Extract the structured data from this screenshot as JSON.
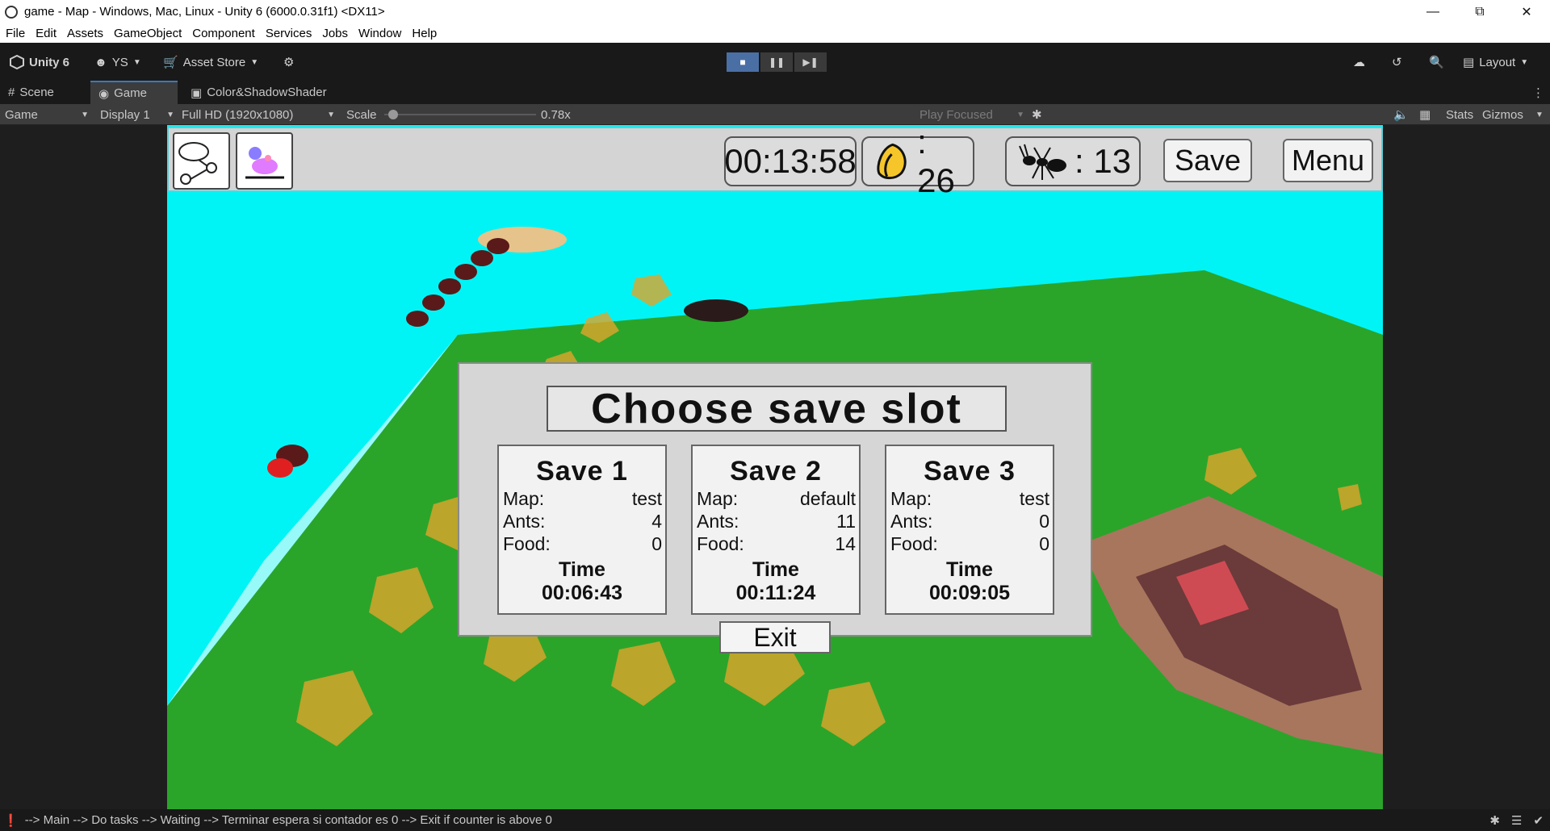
{
  "window": {
    "title": "game - Map - Windows, Mac, Linux - Unity 6 (6000.0.31f1) <DX11>",
    "minimize_icon": "minimize-icon",
    "maximize_icon": "restore-icon",
    "close_icon": "close-icon"
  },
  "menu": [
    "File",
    "Edit",
    "Assets",
    "GameObject",
    "Component",
    "Services",
    "Jobs",
    "Window",
    "Help"
  ],
  "toolbar": {
    "unity_label": "Unity 6",
    "account_label": "YS",
    "asset_store_label": "Asset Store",
    "layout_label": "Layout"
  },
  "tabs": [
    "Scene",
    "Game",
    "Color&ShadowShader"
  ],
  "game_bar": {
    "view_select": "Game",
    "display_select": "Display 1",
    "resolution_select": "Full HD (1920x1080)",
    "scale_label": "Scale",
    "scale_value": "0.78x",
    "scale_fraction": 0.03,
    "play_mode_select": "Play Focused",
    "stats_label": "Stats",
    "gizmos_label": "Gizmos"
  },
  "hud": {
    "timer": "00:13:58",
    "food_count": ": 26",
    "ant_count": ": 13",
    "save_label": "Save",
    "menu_label": "Menu"
  },
  "dialog": {
    "title": "Choose save slot",
    "slots": [
      {
        "name": "Save 1",
        "map_label": "Map:",
        "map": "test",
        "ants_label": "Ants:",
        "ants": "4",
        "food_label": "Food:",
        "food": "0",
        "time_label": "Time",
        "time": "00:06:43"
      },
      {
        "name": "Save 2",
        "map_label": "Map:",
        "map": "default",
        "ants_label": "Ants:",
        "ants": "11",
        "food_label": "Food:",
        "food": "14",
        "time_label": "Time",
        "time": "00:11:24"
      },
      {
        "name": "Save 3",
        "map_label": "Map:",
        "map": "test",
        "ants_label": "Ants:",
        "ants": "0",
        "food_label": "Food:",
        "food": "0",
        "time_label": "Time",
        "time": "00:09:05"
      }
    ],
    "exit_label": "Exit"
  },
  "status_bar": {
    "message": "--> Main --> Do tasks --> Waiting --> Terminar espera si contador es 0 --> Exit if counter is above 0"
  },
  "colors": {
    "sky": "#00f4f6",
    "ground": "#2aa52a",
    "food": "#e0a52a",
    "nest": "#c85a5a",
    "accent": "#4a6fa5"
  }
}
